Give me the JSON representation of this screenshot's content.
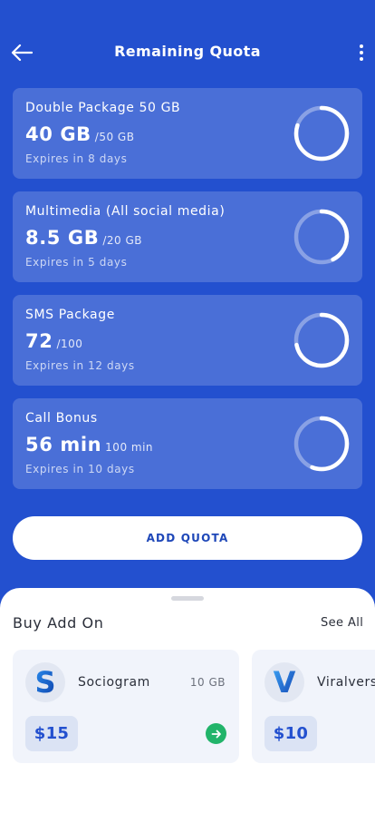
{
  "header": {
    "title": "Remaining Quota",
    "back_icon": "arrow-left-icon",
    "menu_icon": "more-vertical-icon"
  },
  "quotas": [
    {
      "name": "Double Package 50 GB",
      "remaining": "40 GB",
      "total": "/50 GB",
      "expiry": "Expires in 8 days",
      "fraction": 0.8
    },
    {
      "name": "Multimedia (All social media)",
      "remaining": "8.5 GB",
      "total": "/20 GB",
      "expiry": "Expires in 5 days",
      "fraction": 0.425
    },
    {
      "name": "SMS Package",
      "remaining": "72",
      "total": "/100",
      "expiry": "Expires in 12 days",
      "fraction": 0.72
    },
    {
      "name": "Call Bonus",
      "remaining": "56 min",
      "total": "100 min",
      "expiry": "Expires in 10 days",
      "fraction": 0.56
    }
  ],
  "add_quota_label": "ADD QUOTA",
  "addons": {
    "title": "Buy Add On",
    "see_all": "See All",
    "items": [
      {
        "name": "Sociogram",
        "size": "10 GB",
        "price": "$15",
        "logo_letter": "S",
        "action_icon": "arrow-right-icon"
      },
      {
        "name": "Viralverse",
        "size": "",
        "price": "$10",
        "logo_letter": "V",
        "action_icon": "arrow-right-icon"
      }
    ]
  },
  "colors": {
    "background": "#2350cf",
    "card": "rgba(255,255,255,0.18)",
    "ring_active": "#ffffff",
    "ring_track": "rgba(255,255,255,0.35)",
    "accent_green": "#22b46a",
    "price_text": "#2350cf"
  }
}
